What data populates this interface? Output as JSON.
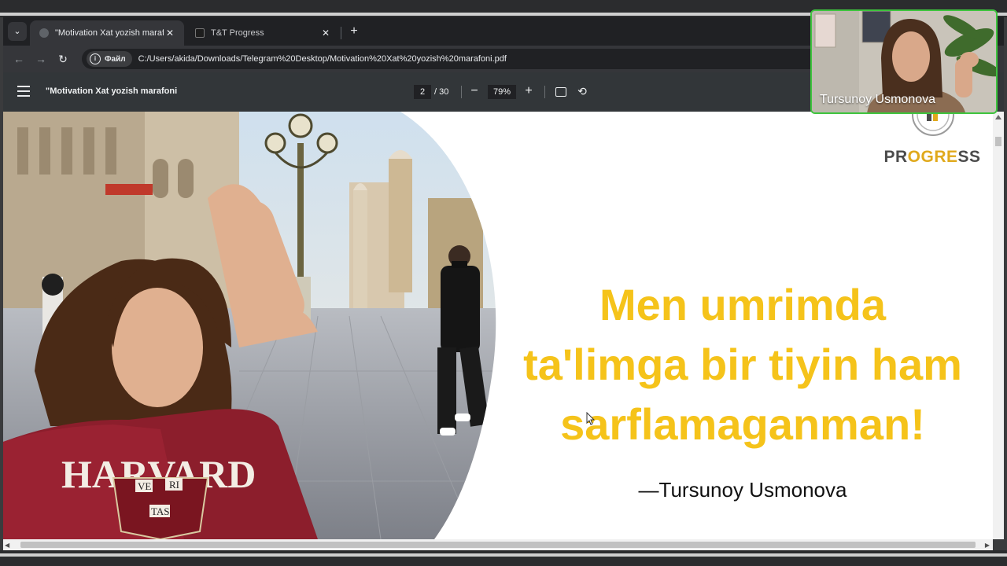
{
  "tabs": [
    {
      "title": "\"Motivation Xat yozish marafoni",
      "active": true
    },
    {
      "title": "T&T Progress",
      "active": false
    }
  ],
  "address_bar": {
    "chip_label": "Файл",
    "url": "C:/Users/akida/Downloads/Telegram%20Desktop/Motivation%20Xat%20yozish%20marafoni.pdf"
  },
  "pdf_toolbar": {
    "title": "\"Motivation Xat yozish marafoni",
    "current_page": "2",
    "total_pages": "/ 30",
    "zoom": "79%"
  },
  "slide": {
    "logo_text": "PROGRESS",
    "quote_lines": [
      "Men umrimda",
      "ta'limga bir tiyin ham",
      "sarflamaganman!"
    ],
    "author": "—Tursunoy Usmonova",
    "shirt_text": "HARVARD",
    "shirt_crest": [
      "VE",
      "RI",
      "TAS"
    ]
  },
  "video": {
    "participant_name": "Tursunoy Usmonova"
  },
  "colors": {
    "quote": "#f5c31a",
    "logo_accent": "#e0a91c",
    "video_border": "#3ec43e"
  }
}
